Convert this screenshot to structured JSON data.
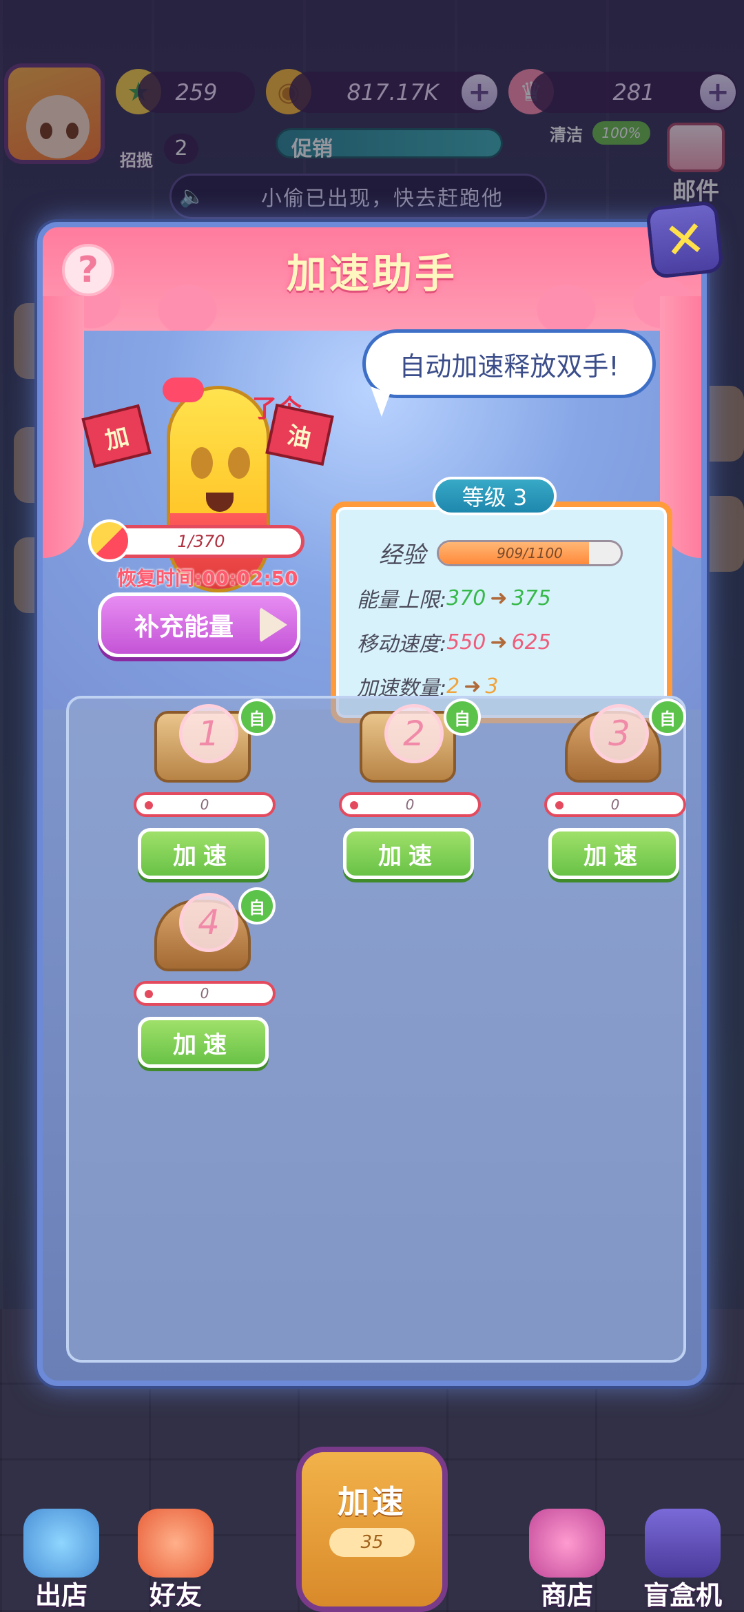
{
  "top_bar": {
    "stars": "259",
    "coins": "817.17K",
    "crowns": "281",
    "zhaolan_label": "招揽",
    "zhaolan_count": "2",
    "promo_label": "促销",
    "clean_label": "清洁",
    "clean_value": "100%",
    "mail_label": "邮件",
    "news": "小偷已出现，快去赶跑他"
  },
  "popup": {
    "title": "加速助手",
    "help_icon": "question-icon",
    "close_icon": "close-icon",
    "bubble": "自动加速释放双手!",
    "mascot": {
      "text_top": "了个",
      "flag_left": "加",
      "flag_right": "油"
    },
    "energy": "1/370",
    "recover_time": "恢复时间:00:02:50",
    "refill_button": "补充能量",
    "level": "等级 3",
    "stats": {
      "exp_label": "经验",
      "exp_value": "909/1100",
      "exp_fraction": 0.826,
      "energy_cap_label": "能量上限:",
      "energy_cap_from": "370",
      "energy_cap_to": "375",
      "move_speed_label": "移动速度:",
      "move_speed_from": "550",
      "move_speed_to": "625",
      "boost_count_label": "加速数量:",
      "boost_count_from": "2",
      "boost_count_to": "3",
      "arrow": "➜"
    },
    "slots": [
      {
        "num": "1",
        "auto": "自",
        "value": "0",
        "button": "加速"
      },
      {
        "num": "2",
        "auto": "自",
        "value": "0",
        "button": "加速"
      },
      {
        "num": "3",
        "auto": "自",
        "value": "0",
        "button": "加速"
      },
      {
        "num": "4",
        "auto": "自",
        "value": "0",
        "button": "加速"
      }
    ]
  },
  "bottom_nav": {
    "leave_store": "出店",
    "friends": "好友",
    "speed_up": "加速",
    "speed_up_count": "35",
    "shop": "商店",
    "blind_box": "盲盒机"
  },
  "colors": {
    "accent_pink": "#ff7c9e",
    "button_green": "#68c246",
    "button_purple": "#c454d6",
    "panel_orange": "#ff9b3a"
  }
}
